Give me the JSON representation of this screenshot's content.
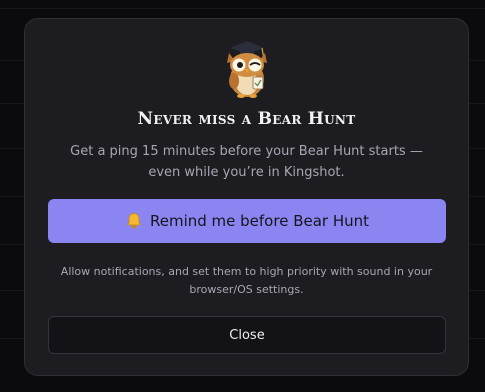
{
  "dialog": {
    "title": "Never miss a Bear Hunt",
    "subtitle": "Get a ping 15 minutes before your Bear Hunt starts — even while you’re in Kingshot.",
    "remind_button_label": "Remind me before Bear Hunt",
    "remind_button_icon": "bell-icon",
    "hint": "Allow notifications, and set them to high priority with sound in your browser/OS settings.",
    "close_button_label": "Close",
    "mascot": "owl-mascot"
  },
  "colors": {
    "accent": "#8b85f2",
    "modal_background": "#1c1c21",
    "page_background": "#0b0b0d",
    "title_text": "#f2f2f5",
    "muted_text": "#a7a7b3"
  }
}
